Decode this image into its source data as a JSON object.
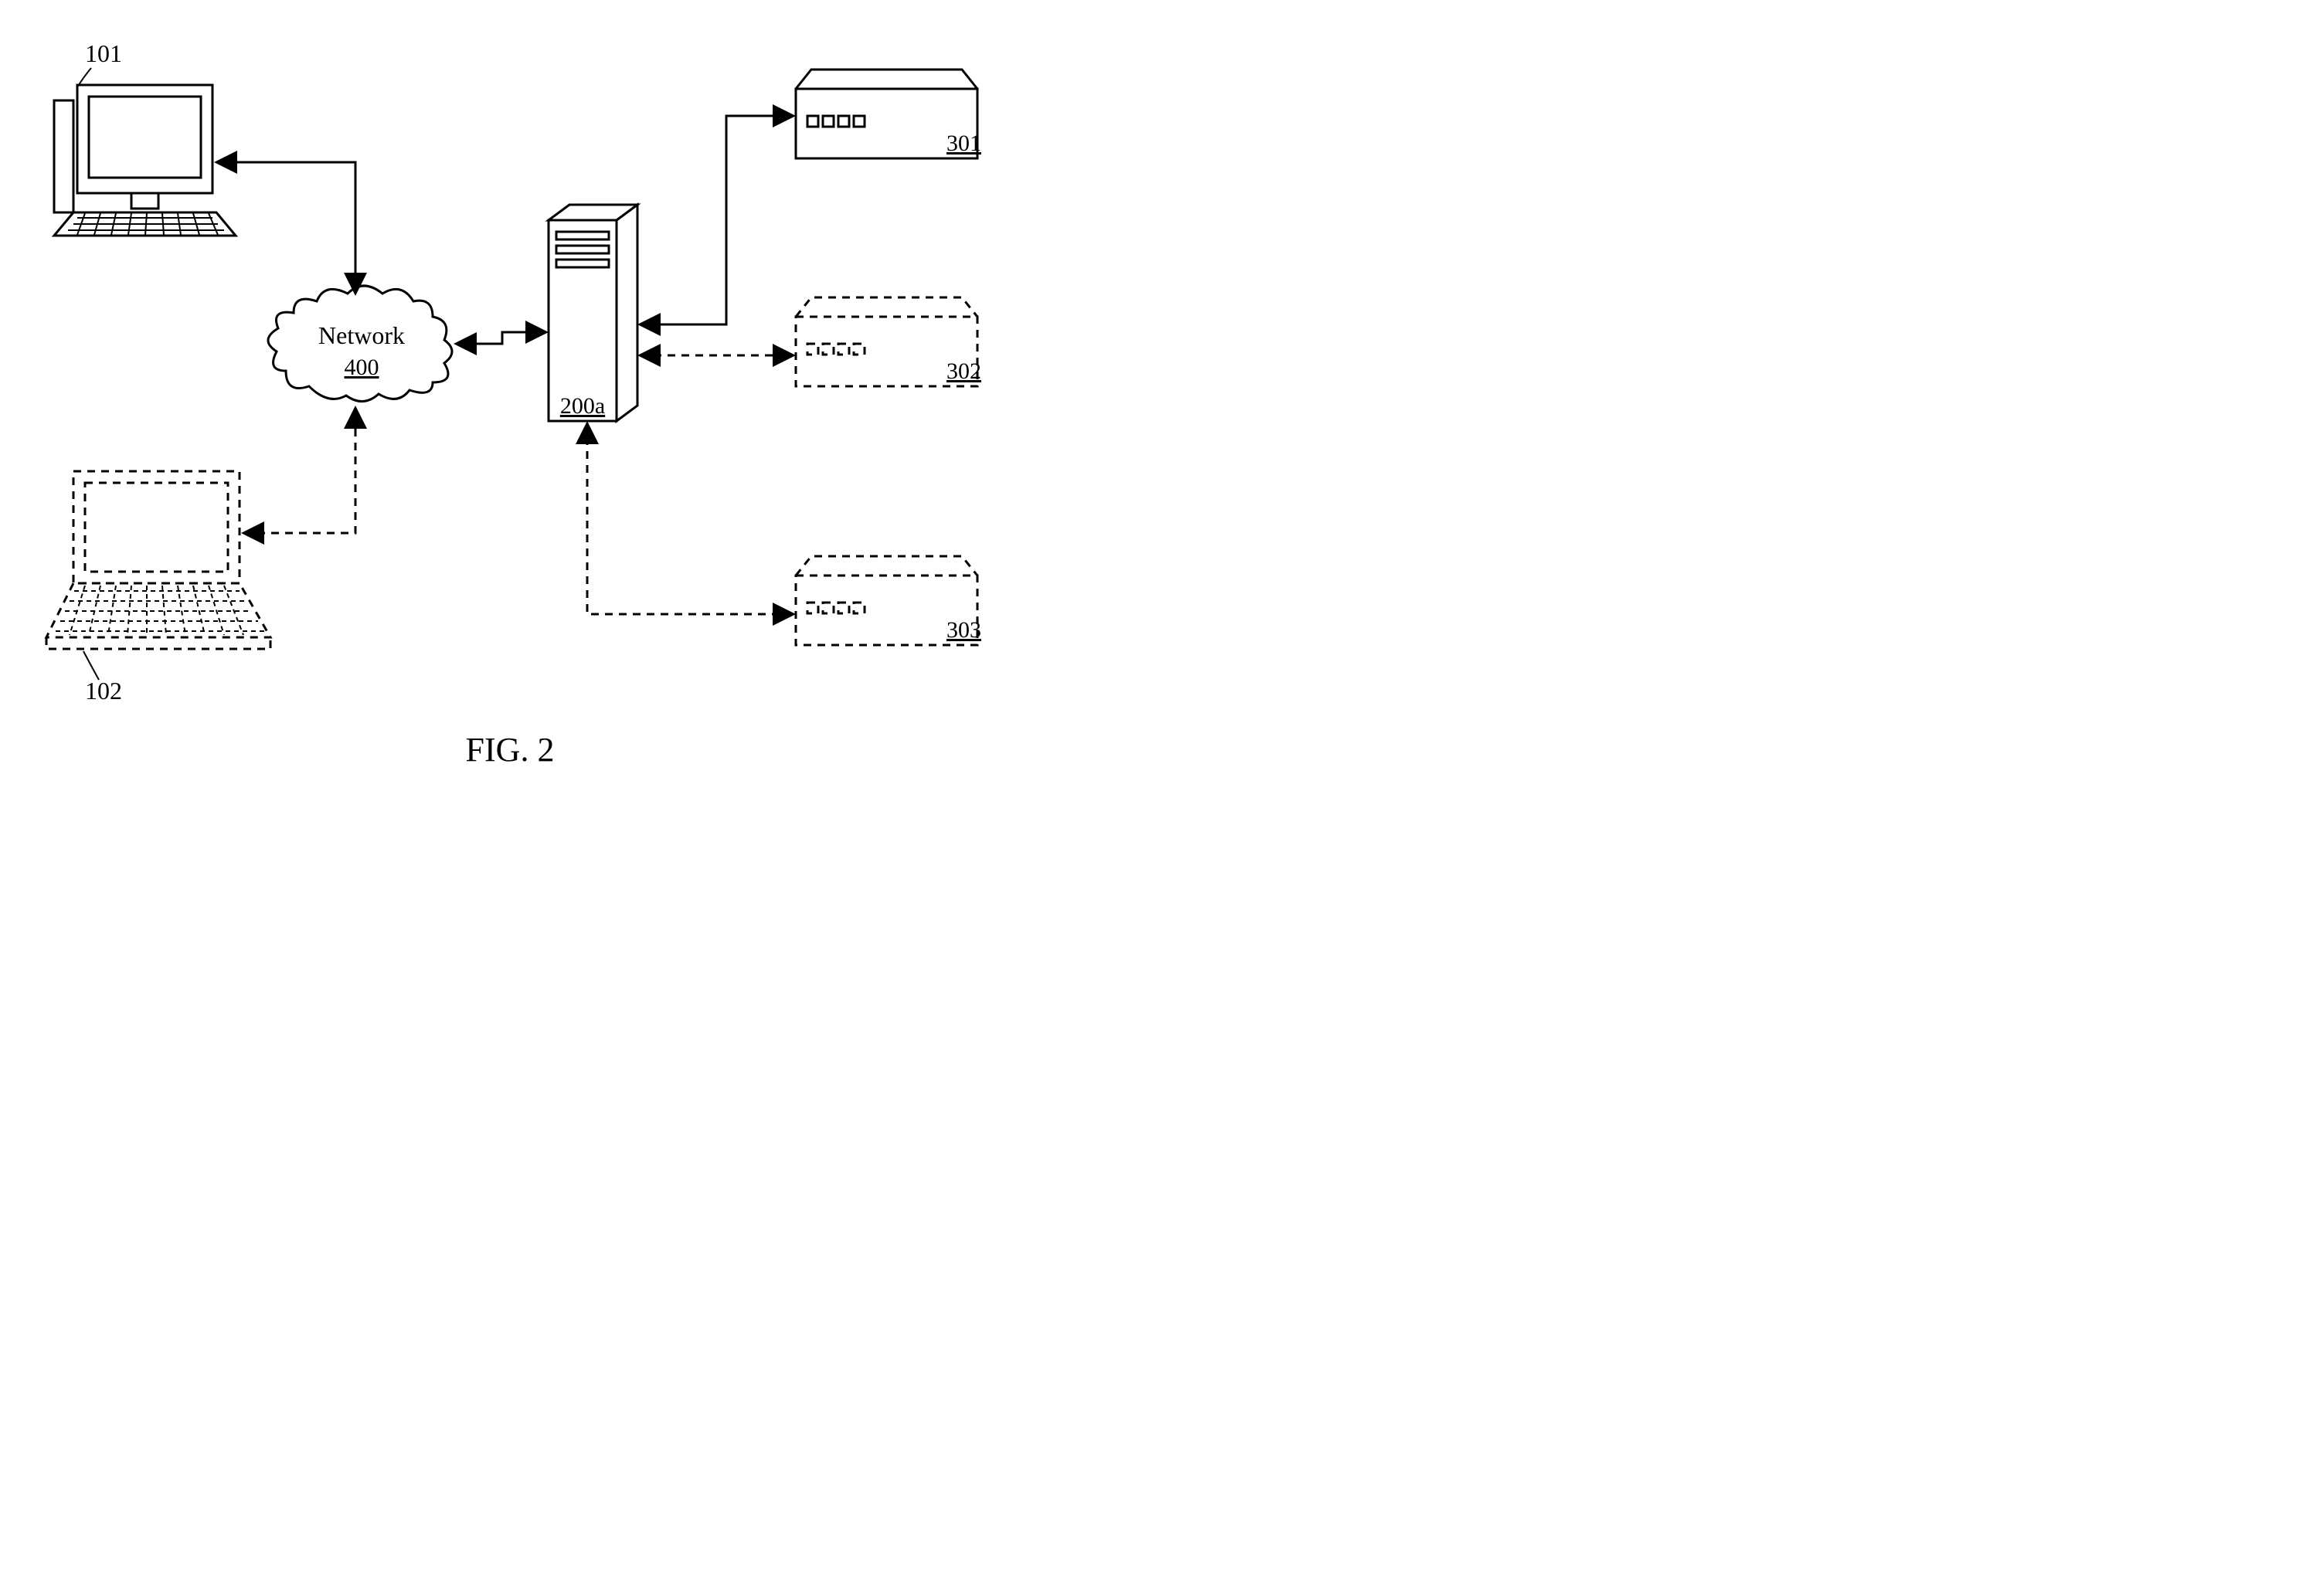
{
  "figure_label": "FIG. 2",
  "nodes": {
    "desktop": {
      "ref": "101"
    },
    "laptop": {
      "ref": "102"
    },
    "network": {
      "label": "Network",
      "ref": "400"
    },
    "server": {
      "ref": "200a"
    },
    "storage_top": {
      "ref": "301"
    },
    "storage_mid": {
      "ref": "302"
    },
    "storage_bot": {
      "ref": "303"
    }
  }
}
